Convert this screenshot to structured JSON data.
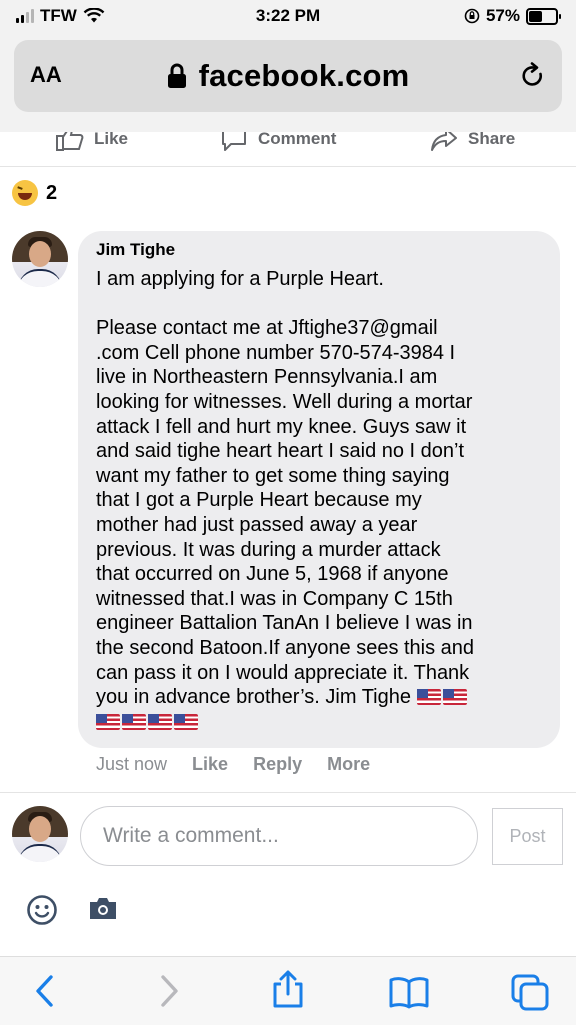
{
  "status_bar": {
    "carrier": "TFW",
    "time": "3:22 PM",
    "battery": "57%"
  },
  "browser": {
    "text_size_label": "AA",
    "url": "facebook.com"
  },
  "post_actions": {
    "like": "Like",
    "comment": "Comment",
    "share": "Share"
  },
  "reactions": {
    "count": "2",
    "icon": "laugh-emoji-icon"
  },
  "comment": {
    "author": "Jim Tighe",
    "body": "I am applying for a Purple Heart.\n\nPlease contact me at Jftighe37@gmail\n.com Cell phone number 570-574-3984 I\nlive in Northeastern Pennsylvania.I am\nlooking for witnesses. Well during a mortar\nattack I fell and hurt my knee. Guys saw it\nand said tighe heart heart I said no I don’t\nwant my father to get some thing saying\nthat I got a Purple Heart because my\nmother had just passed away a year\nprevious. It was during a murder attack\nthat occurred on June 5, 1968 if anyone\nwitnessed that.I was in Company C 15th\nengineer Battalion TanAn I believe I was in\nthe second Batoon.If anyone sees this and\ncan pass it on I would appreciate it. Thank\nyou in advance brother’s. Jim Tighe",
    "flag_emoji_count": 6,
    "timestamp": "Just now",
    "like": "Like",
    "reply": "Reply",
    "more": "More"
  },
  "composer": {
    "placeholder": "Write a comment...",
    "post_label": "Post"
  },
  "colors": {
    "bubble": "#ededef",
    "meta_text": "#8a8d91",
    "toolbar_icon": "#1a7fe8"
  }
}
